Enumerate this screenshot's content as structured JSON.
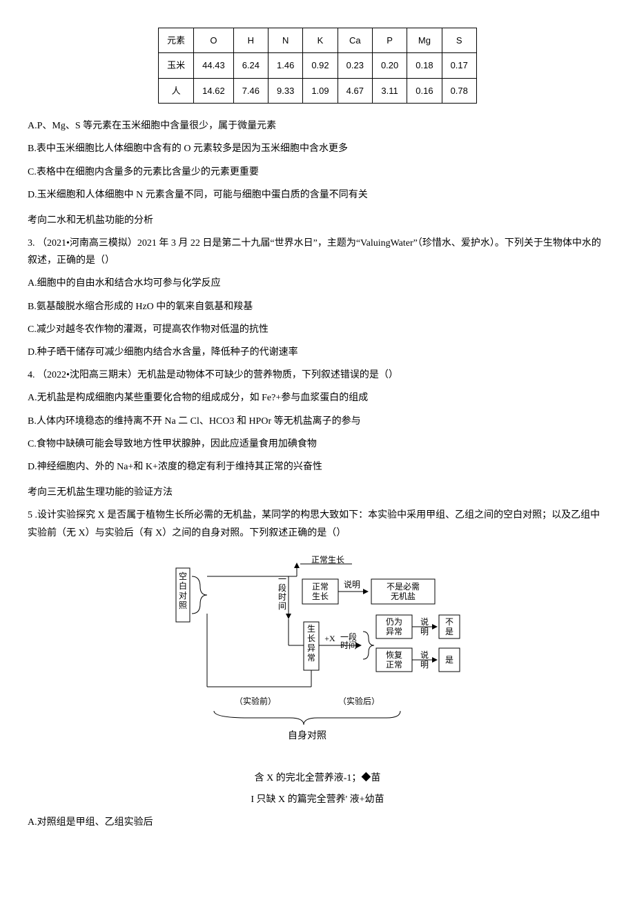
{
  "table": {
    "headers": [
      "元素",
      "O",
      "H",
      "N",
      "K",
      "Ca",
      "P",
      "Mg",
      "S"
    ],
    "rows": [
      {
        "label": "玉米",
        "values": [
          "44.43",
          "6.24",
          "1.46",
          "0.92",
          "0.23",
          "0.20",
          "0.18",
          "0.17"
        ]
      },
      {
        "label": "人",
        "values": [
          "14.62",
          "7.46",
          "9.33",
          "1.09",
          "4.67",
          "3.11",
          "0.16",
          "0.78"
        ]
      }
    ]
  },
  "q_common_options": {
    "A": "A.P、Mg、S 等元素在玉米细胞中含量很少，属于微量元素",
    "B": "B.表中玉米细胞比人体细胞中含有的 O 元素较多是因为玉米细胞中含水更多",
    "C": "C.表格中在细胞内含量多的元素比含量少的元素更重要",
    "D": "D.玉米细胞和人体细胞中 N 元素含量不同，可能与细胞中蛋白质的含量不同有关"
  },
  "section2_heading": "考向二水和无机盐功能的分析",
  "q3": {
    "stem": "3. （2021•河南高三模拟）2021 年 3 月 22 日是第二十九届“世界水日”，主题为“ValuingWater”（珍惜水、爱护水）。下列关于生物体中水的叙述，正确的是（）",
    "A": "A.细胞中的自由水和结合水均可参与化学反应",
    "B": "B.氨基酸脱水缩合形成的 HzO 中的氧来自氨基和羧基",
    "C": "C.减少对越冬农作物的灌溉，可提高农作物对低温的抗性",
    "D": "D.种子晒干储存可减少细胞内结合水含量，降低种子的代谢速率"
  },
  "q4": {
    "stem": "4. （2022•沈阳高三期末）无机盐是动物体不可缺少的营养物质，下列叙述错误的是（）",
    "A": "A.无机盐是构成细胞内某些重要化合物的组成成分，如 Fe?+参与血浆蛋白的组成",
    "B": "B.人体内环境稳态的维持离不开 Na 二 Cl、HCO3 和 HPOr 等无机盐离子的参与",
    "C": "C.食物中缺碘可能会导致地方性甲状腺肿，因此应适量食用加碘食物",
    "D": "D.神经细胞内、外的 Na+和 K+浓度的稳定有利于维持其正常的兴奋性"
  },
  "section3_heading": "考向三无机盐生理功能的验证方法",
  "q5": {
    "stem": "5 .设计实验探究 X 是否属于植物生长所必需的无机盐，某同学的构思大致如下：本实验中采用甲组、乙组之间的空白对照；以及乙组中实验前（无 X）与实验后（有 X）之间的自身对照。下列叙述正确的是（）",
    "A": "A.对照组是甲组、乙组实验后"
  },
  "diagram": {
    "blank_control": "空白对照",
    "normal_growth_top": "正常生长",
    "period": "一段时间",
    "normal_growth": "正常生长",
    "explain": "说明",
    "not_required": "不是必需无机盐",
    "abnormal": "生长异常",
    "plus_x": "+X",
    "period2": "一段时间",
    "still_abnormal": "仍为异常",
    "explain2": "说明",
    "is_not": "不是",
    "recover": "恢复正常",
    "explain3": "说明",
    "is_yes": "是",
    "before": "（实验前）",
    "after": "（实验后）",
    "self_control": "自身对照",
    "caption1": "含 X 的完北全营养液-1；◆苗",
    "caption2": "I 只缺 X 的篇完全营养' 液+幼苗"
  }
}
